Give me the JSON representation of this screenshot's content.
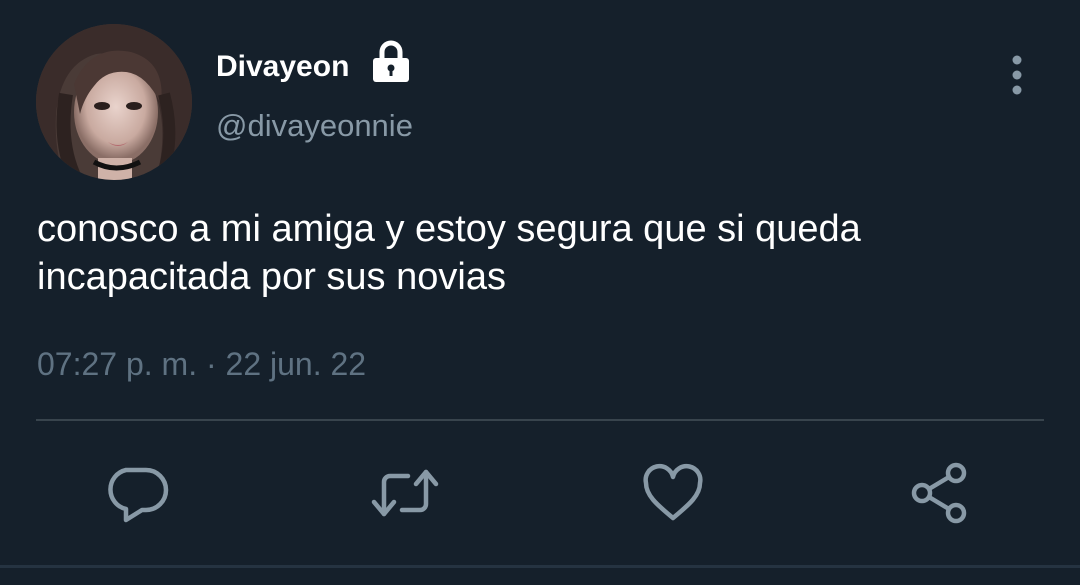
{
  "author": {
    "display_name": "Divayeon",
    "handle": "@divayeonnie",
    "protected": true
  },
  "tweet": {
    "text": "conosco a mi amiga y estoy segura que si queda incapacitada por sus novias",
    "time": "07:27 p. m.",
    "separator": " · ",
    "date": "22 jun. 22"
  },
  "actions": [
    "reply-icon",
    "retweet-icon",
    "like-icon",
    "share-icon"
  ],
  "colors": {
    "background": "#15202b",
    "primary_text": "#ffffff",
    "secondary_text": "#8899a6",
    "icon": "#8899a6",
    "divider": "#38444d"
  }
}
